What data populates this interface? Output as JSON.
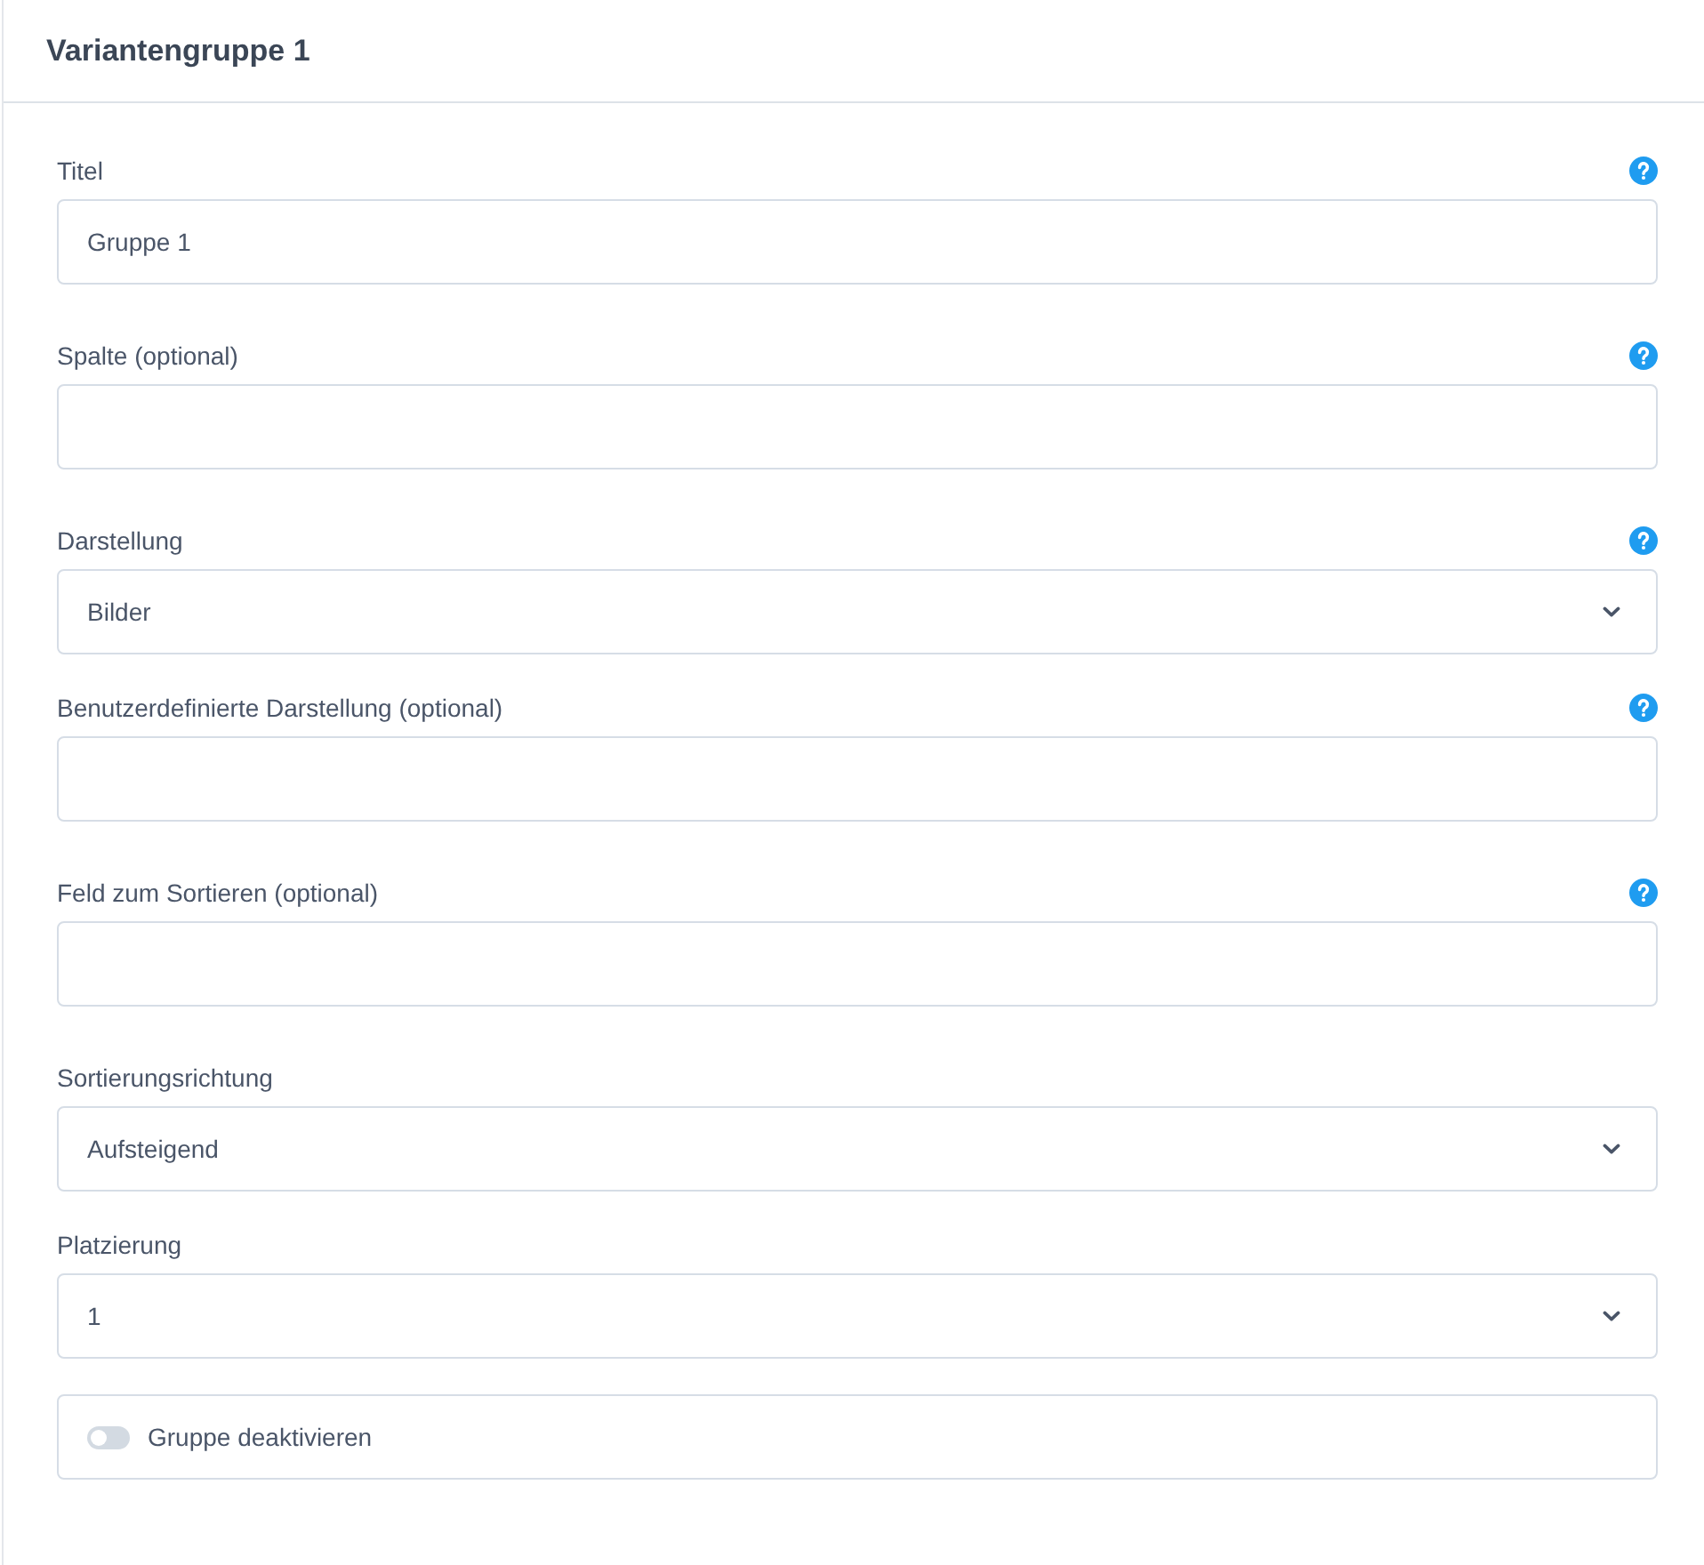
{
  "panel": {
    "title": "Variantengruppe 1"
  },
  "fields": [
    {
      "kind": "text",
      "label": "Titel",
      "value": "Gruppe 1",
      "help": true
    },
    {
      "kind": "text",
      "label": "Spalte (optional)",
      "help": true
    },
    {
      "kind": "select",
      "label": "Darstellung",
      "value": "Bilder",
      "help": true
    },
    {
      "kind": "text",
      "label": "Benutzerdefinierte Darstellung (optional)",
      "help": true
    },
    {
      "kind": "text",
      "label": "Feld zum Sortieren (optional)",
      "help": true
    },
    {
      "kind": "select",
      "label": "Sortierungsrichtung",
      "value": "Aufsteigend",
      "help": false
    },
    {
      "kind": "select",
      "label": "Platzierung",
      "value": "1",
      "help": false
    },
    {
      "kind": "toggle",
      "label": "Gruppe deaktivieren",
      "on": false
    }
  ]
}
